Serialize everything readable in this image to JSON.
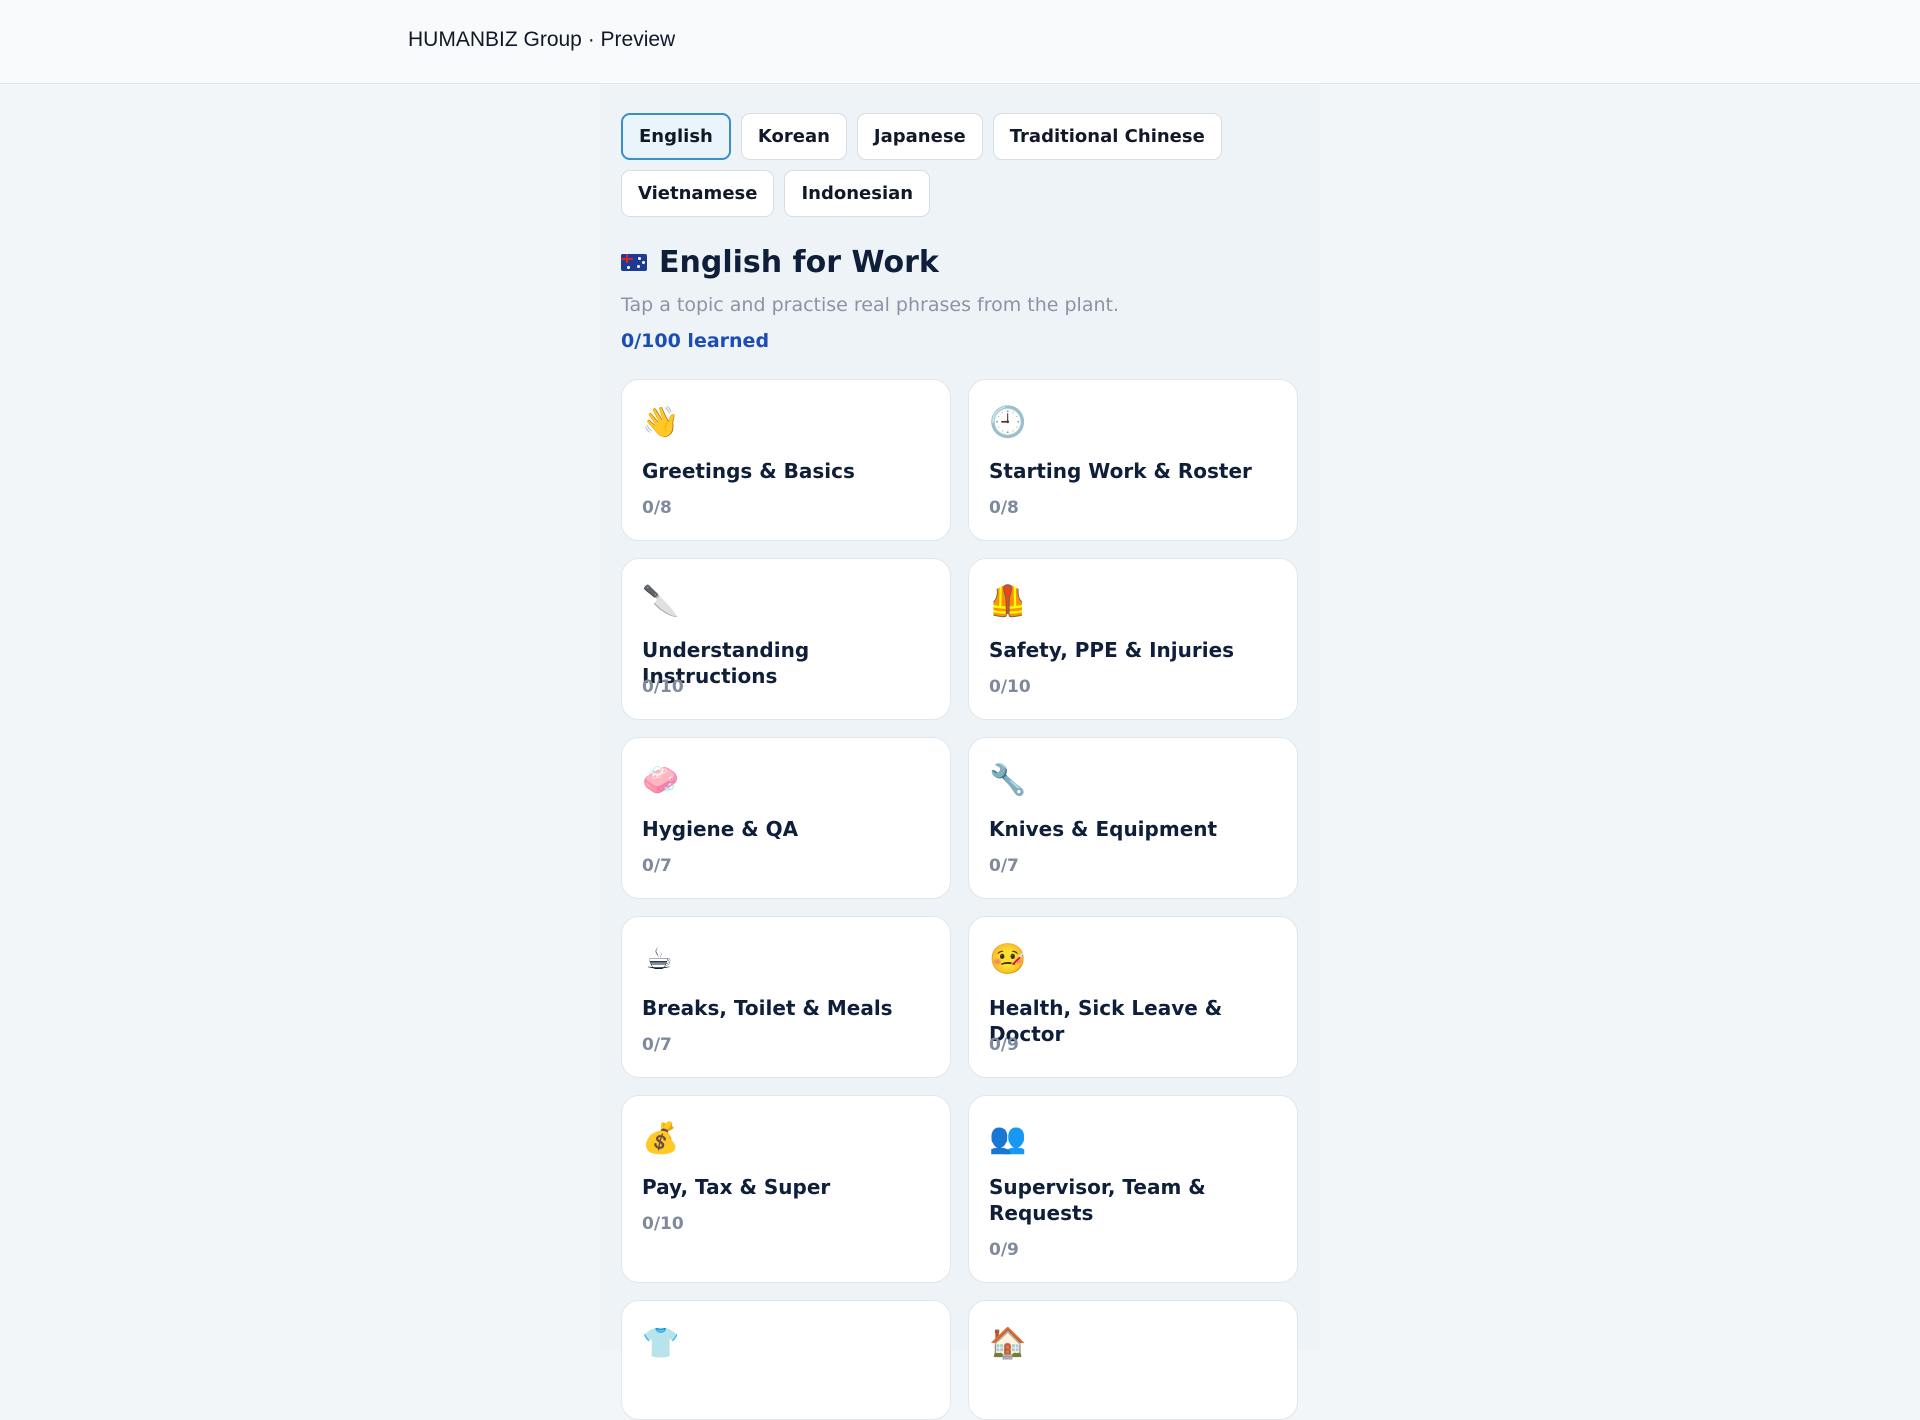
{
  "header": {
    "title": "HUMANBIZ Group · Preview"
  },
  "languages": [
    {
      "label": "English",
      "active": true
    },
    {
      "label": "Korean",
      "active": false
    },
    {
      "label": "Japanese",
      "active": false
    },
    {
      "label": "Traditional Chinese",
      "active": false
    },
    {
      "label": "Vietnamese",
      "active": false
    },
    {
      "label": "Indonesian",
      "active": false
    }
  ],
  "main": {
    "flag_icon": "australia-flag-icon",
    "title": "English for Work",
    "subtitle": "Tap a topic and practise real phrases from the plant.",
    "progress": "0/100 learned"
  },
  "topics": [
    {
      "icon": "waving-hand-icon",
      "glyph": "👋",
      "title": "Greetings & Basics",
      "count": "0/8"
    },
    {
      "icon": "clock-icon",
      "glyph": "🕘",
      "title": "Starting Work & Roster",
      "count": "0/8"
    },
    {
      "icon": "knife-icon",
      "glyph": "🔪",
      "title": "Understanding Instructions",
      "count": "0/10"
    },
    {
      "icon": "safety-vest-icon",
      "glyph": "🦺",
      "title": "Safety, PPE & Injuries",
      "count": "0/10"
    },
    {
      "icon": "soap-icon",
      "glyph": "🧼",
      "title": "Hygiene & QA",
      "count": "0/7"
    },
    {
      "icon": "wrench-icon",
      "glyph": "🔧",
      "title": "Knives & Equipment",
      "count": "0/7"
    },
    {
      "icon": "coffee-icon",
      "glyph": "☕",
      "title": "Breaks, Toilet & Meals",
      "count": "0/7"
    },
    {
      "icon": "sick-face-icon",
      "glyph": "🤒",
      "title": "Health, Sick Leave & Doctor",
      "count": "0/9"
    },
    {
      "icon": "money-bag-icon",
      "glyph": "💰",
      "title": "Pay, Tax & Super",
      "count": "0/10"
    },
    {
      "icon": "people-icon",
      "glyph": "👥",
      "title": "Supervisor, Team & Requests",
      "count": "0/9"
    },
    {
      "icon": "shirt-icon",
      "glyph": "👕",
      "title": "",
      "count": ""
    },
    {
      "icon": "house-icon",
      "glyph": "🏠",
      "title": "",
      "count": ""
    }
  ]
}
